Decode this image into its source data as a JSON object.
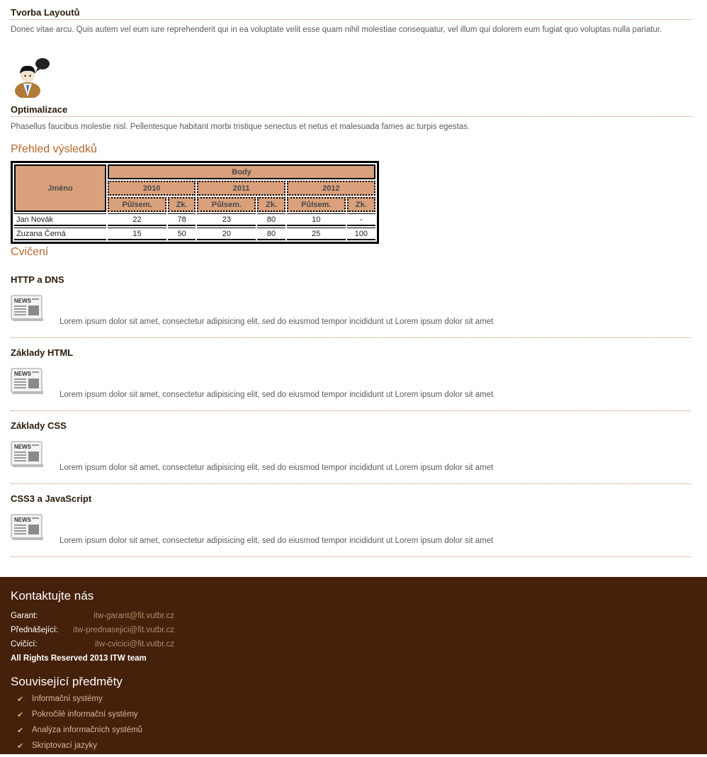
{
  "sections": [
    {
      "title": "Tvorba Layoutů",
      "text": "Donec vitae arcu. Quis autem vel eum iure reprehenderit qui in ea voluptate velit esse quam nihil molestiae consequatur, vel illum qui dolorem eum fugiat quo voluptas nulla pariatur."
    },
    {
      "title": "Optimalizace",
      "text": "Phasellus faucibus molestie nisl. Pellentesque habitant morbi tristique senectus et netus et malesuada fames ac turpis egestas."
    }
  ],
  "results": {
    "heading": "Přehled výsledků",
    "col_name": "Jméno",
    "col_body": "Body",
    "years": [
      "2010",
      "2011",
      "2012"
    ],
    "sub": {
      "a": "Půlsem.",
      "b": "Zk."
    },
    "rows": [
      {
        "name": "Jan Novák",
        "v": [
          "22",
          "78",
          "23",
          "80",
          "10",
          "-"
        ]
      },
      {
        "name": "Zuzana Černá",
        "v": [
          "15",
          "50",
          "20",
          "80",
          "25",
          "100"
        ]
      }
    ]
  },
  "exercises": {
    "heading": "Cvičení",
    "icon_label": "NEWS",
    "items": [
      {
        "title": "HTTP a DNS",
        "text": "Lorem ipsum dolor sit amet, consectetur adipisicing elit, sed do eiusmod tempor incididunt ut Lorem ipsum dolor sit amet"
      },
      {
        "title": "Základy HTML",
        "text": "Lorem ipsum dolor sit amet, consectetur adipisicing elit, sed do eiusmod tempor incididunt ut Lorem ipsum dolor sit amet"
      },
      {
        "title": "Základy CSS",
        "text": "Lorem ipsum dolor sit amet, consectetur adipisicing elit, sed do eiusmod tempor incididunt ut Lorem ipsum dolor sit amet"
      },
      {
        "title": "CSS3 a JavaScript",
        "text": "Lorem ipsum dolor sit amet, consectetur adipisicing elit, sed do eiusmod tempor incididunt ut Lorem ipsum dolor sit amet"
      }
    ]
  },
  "footer": {
    "contact_heading": "Kontaktujte nás",
    "contacts": [
      {
        "label": "Garant:",
        "email": "itw-garant@fit.vutbr.cz"
      },
      {
        "label": "Přednášející:",
        "email": "itw-prednasejici@fit.vutbr.cz"
      },
      {
        "label": "Cvičící:",
        "email": "itw-cvicici@fit.vutbr.cz"
      }
    ],
    "rights": "All Rights Reserved 2013 ITW team",
    "related_heading": "Související předměty",
    "related": [
      "Informační systémy",
      "Pokročilé informační systémy",
      "Analýza informačních systémů",
      "Skriptovací jazyky"
    ]
  },
  "colors": {
    "accent": "#b5652c",
    "footer_bg": "#45200a",
    "table_header": "#d9a07c"
  }
}
